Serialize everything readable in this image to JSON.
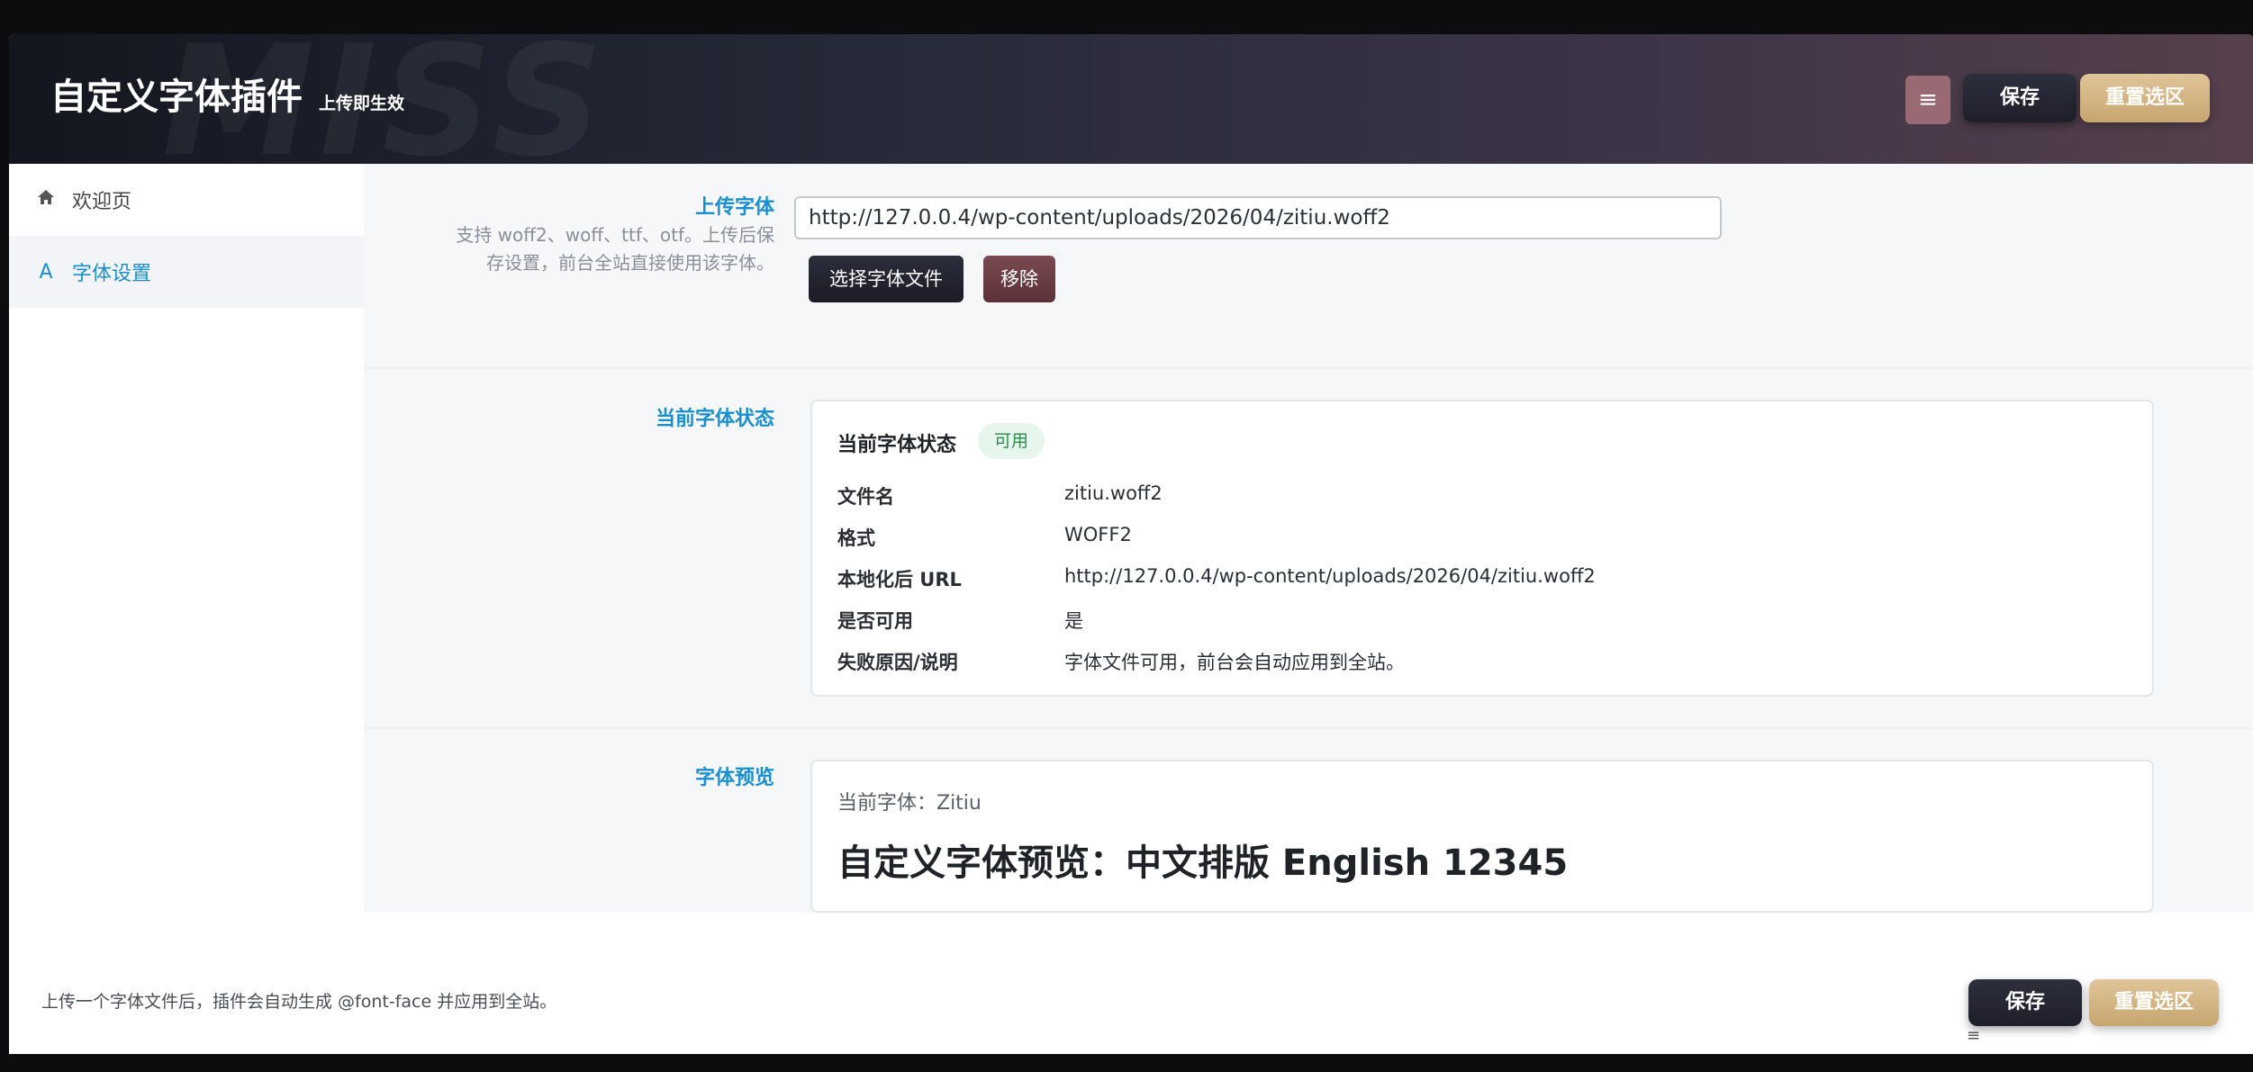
{
  "header": {
    "watermark": "MISS",
    "title": "自定义字体插件",
    "subtitle": "上传即生效",
    "menu_icon": "≡",
    "save_label": "保存",
    "reset_label": "重置选区"
  },
  "sidebar": {
    "items": [
      {
        "icon": "home-icon",
        "glyph": "⌂",
        "label": "欢迎页"
      },
      {
        "icon": "font-icon",
        "glyph": "A",
        "label": "字体设置"
      }
    ]
  },
  "upload": {
    "title": "上传字体",
    "desc_line1": "支持 woff2、woff、ttf、otf。上传后保",
    "desc_line2": "存设置，前台全站直接使用该字体。",
    "url_value": "http://127.0.0.4/wp-content/uploads/2026/04/zitiu.woff2",
    "choose_label": "选择字体文件",
    "remove_label": "移除"
  },
  "status": {
    "section_title": "当前字体状态",
    "card_title": "当前字体状态",
    "badge": "可用",
    "rows": [
      {
        "key": "文件名",
        "value": "zitiu.woff2"
      },
      {
        "key": "格式",
        "value": "WOFF2"
      },
      {
        "key": "本地化后 URL",
        "value": "http://127.0.0.4/wp-content/uploads/2026/04/zitiu.woff2"
      },
      {
        "key": "是否可用",
        "value": "是"
      },
      {
        "key": "失败原因/说明",
        "value": "字体文件可用，前台会自动应用到全站。"
      }
    ]
  },
  "preview": {
    "section_title": "字体预览",
    "current_font": "当前字体：Zitiu",
    "sample": "自定义字体预览：中文排版 English 12345"
  },
  "footer": {
    "text": "上传一个字体文件后，插件会自动生成 @font-face 并应用到全站。",
    "save_label": "保存",
    "reset_label": "重置选区",
    "handle": "≡"
  }
}
